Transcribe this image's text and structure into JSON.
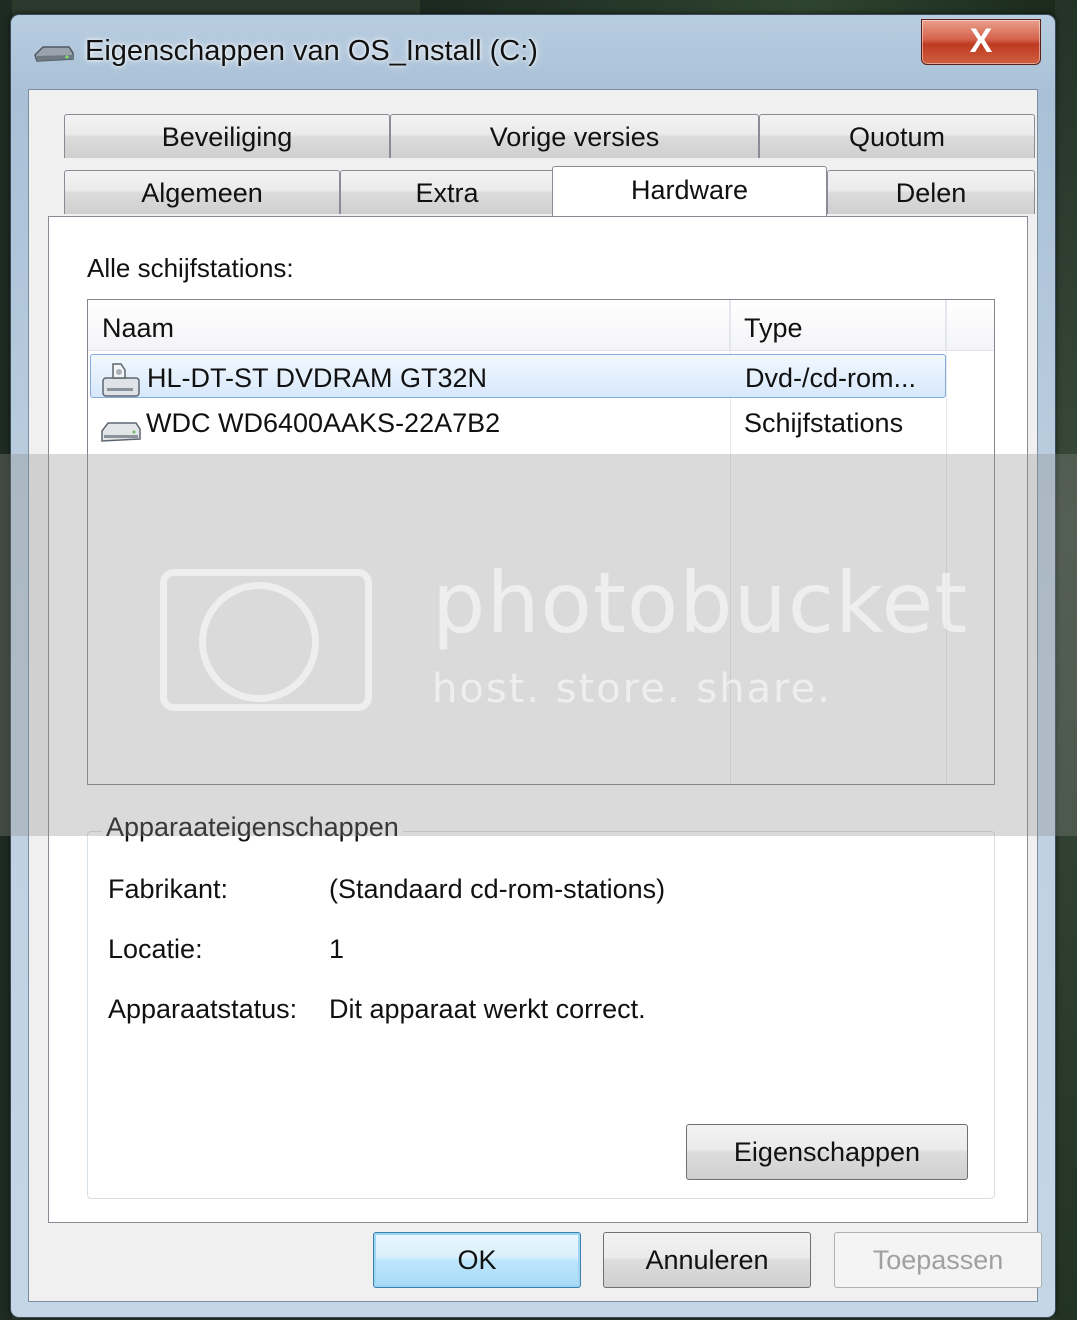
{
  "window": {
    "title": "Eigenschappen van OS_Install (C:)",
    "close_label": "X",
    "icon": "drive-icon"
  },
  "tabs": {
    "row1": [
      {
        "label": "Beveiliging"
      },
      {
        "label": "Vorige versies"
      },
      {
        "label": "Quotum"
      }
    ],
    "row2": [
      {
        "label": "Algemeen"
      },
      {
        "label": "Extra"
      },
      {
        "label": "Hardware",
        "active": true
      },
      {
        "label": "Delen"
      }
    ]
  },
  "hardware": {
    "list_label": "Alle schijfstations:",
    "columns": [
      "Naam",
      "Type"
    ],
    "rows": [
      {
        "name": "HL-DT-ST DVDRAM GT32N",
        "type": "Dvd-/cd-rom...",
        "icon": "dvd-drive-icon",
        "selected": true
      },
      {
        "name": "WDC WD6400AAKS-22A7B2",
        "type": "Schijfstations",
        "icon": "hard-drive-icon",
        "selected": false
      }
    ],
    "group": {
      "title": "Apparaateigenschappen",
      "properties": [
        {
          "key": "Fabrikant:",
          "value": "(Standaard cd-rom-stations)"
        },
        {
          "key": "Locatie:",
          "value": "1"
        },
        {
          "key": "Apparaatstatus:",
          "value": "Dit apparaat werkt correct."
        }
      ],
      "button_label": "Eigenschappen"
    }
  },
  "buttons": {
    "ok": "OK",
    "cancel": "Annuleren",
    "apply": "Toepassen"
  },
  "watermark": {
    "brand": "photobucket",
    "tagline": "host. store. share."
  }
}
